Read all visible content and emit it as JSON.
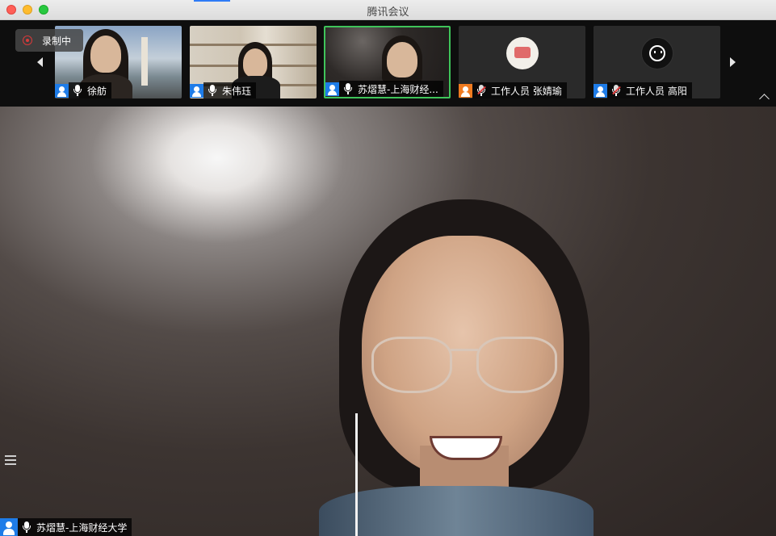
{
  "window": {
    "title": "腾讯会议"
  },
  "recording": {
    "label": "录制中"
  },
  "participants": [
    {
      "name": "徐舫",
      "muted": false,
      "avatar": "video"
    },
    {
      "name": "朱伟珏",
      "muted": false,
      "avatar": "video"
    },
    {
      "name": "苏熠慧-上海财经...",
      "muted": false,
      "avatar": "video",
      "active": true
    },
    {
      "name": "工作人员 张婧瑜",
      "muted": true,
      "avatar": "pink-fish-logo"
    },
    {
      "name": "工作人员 高阳",
      "muted": true,
      "avatar": "cartoon-face"
    }
  ],
  "main_speaker": {
    "name": "苏熠慧-上海财经大学"
  },
  "colors": {
    "active_border": "#3fc45a",
    "user_icon_blue": "#1e7ce8",
    "user_icon_orange": "#f07b20",
    "record_red": "#d93a3a"
  },
  "icons": {
    "prev_page": "triangle-left-icon",
    "next_page": "triangle-right-icon",
    "collapse": "chevron-up-icon",
    "participant_list": "list-icon"
  }
}
